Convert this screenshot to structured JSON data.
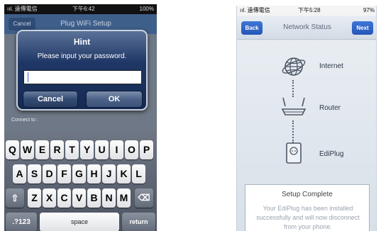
{
  "left_phone": {
    "status": {
      "carrier": "ııl. 遠傳電信",
      "time": "下午6:42",
      "battery": "100%"
    },
    "background": {
      "cancel_label": "Cancel",
      "title": "Plug WiFi Setup",
      "connect_label": "Connect to :"
    },
    "dialog": {
      "title": "Hint",
      "message": "Please input your password.",
      "password_value": "",
      "cancel_label": "Cancel",
      "ok_label": "OK"
    },
    "keyboard": {
      "row1": [
        "Q",
        "W",
        "E",
        "R",
        "T",
        "Y",
        "U",
        "I",
        "O",
        "P"
      ],
      "row2": [
        "A",
        "S",
        "D",
        "F",
        "G",
        "H",
        "J",
        "K",
        "L"
      ],
      "row3": [
        "Z",
        "X",
        "C",
        "V",
        "B",
        "N",
        "M"
      ],
      "shift_glyph": "⇧",
      "delete_glyph": "⌫",
      "numbers_label": ".?123",
      "space_label": "space",
      "return_label": "return"
    }
  },
  "right_phone": {
    "status": {
      "carrier": "ııl. 遠傳電信",
      "time": "下午5:28",
      "battery": "97%"
    },
    "nav": {
      "back_label": "Back",
      "title": "Network Status",
      "next_label": "Next"
    },
    "nodes": [
      {
        "label": "Internet",
        "icon": "globe-icon"
      },
      {
        "label": "Router",
        "icon": "router-icon"
      },
      {
        "label": "EdiPlug",
        "icon": "smart-plug-icon"
      }
    ],
    "panel": {
      "title": "Setup Complete",
      "message": "Your EdiPlug has been installed successfully and will now disconnect from your phone."
    },
    "colors": {
      "nav_button": "#2f63c6",
      "text": "#2e3846"
    }
  }
}
